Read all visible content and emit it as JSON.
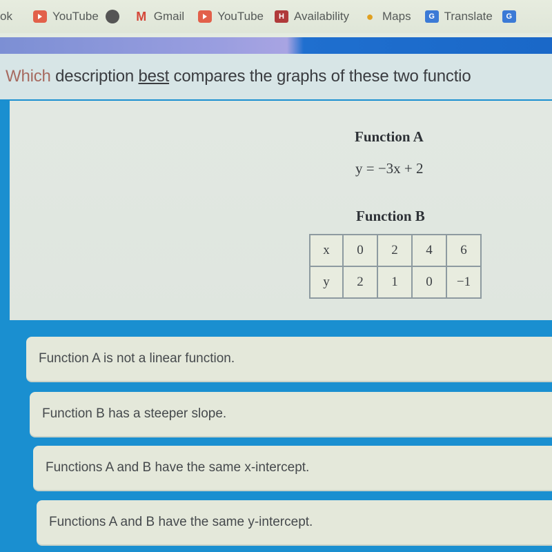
{
  "bookmarks": [
    {
      "label": "ok",
      "icon": "partial"
    },
    {
      "label": "YouTube",
      "icon": "youtube-icon"
    },
    {
      "label": "",
      "icon": "globe-icon"
    },
    {
      "label": "Gmail",
      "icon": "gmail-icon",
      "glyph": "M"
    },
    {
      "label": "YouTube",
      "icon": "youtube-icon"
    },
    {
      "label": "Availability",
      "icon": "availability-icon",
      "glyph": "H"
    },
    {
      "label": "Maps",
      "icon": "maps-icon",
      "glyph": "⬤"
    },
    {
      "label": "Translate",
      "icon": "translate-icon",
      "glyph": "G"
    },
    {
      "label": "",
      "icon": "bookmark-icon",
      "glyph": "G"
    }
  ],
  "question": {
    "lead": "Which",
    "part1": " description ",
    "emphasis": "best",
    "part2": " compares the graphs of these two functio"
  },
  "function_a": {
    "title": "Function A",
    "equation": "y = −3x + 2"
  },
  "function_b": {
    "title": "Function B",
    "table": {
      "x_label": "x",
      "y_label": "y",
      "x": [
        "0",
        "2",
        "4",
        "6"
      ],
      "y": [
        "2",
        "1",
        "0",
        "−1"
      ]
    }
  },
  "choices": [
    "Function A is not a linear function.",
    "Function B has a steeper slope.",
    "Functions A and B have the same x-intercept.",
    "Functions A and B have the same y-intercept."
  ]
}
